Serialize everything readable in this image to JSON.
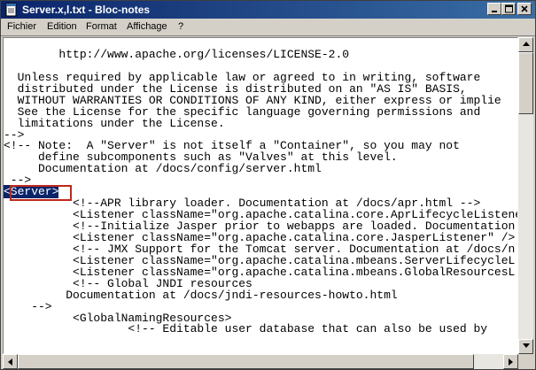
{
  "window": {
    "title": "Server.x,l.txt - Bloc-notes",
    "controls": {
      "minimize": "_",
      "maximize": "□",
      "close": "X"
    }
  },
  "menu": {
    "items": [
      "Fichier",
      "Edition",
      "Format",
      "Affichage",
      "?"
    ]
  },
  "editor": {
    "lines": [
      "",
      "        http://www.apache.org/licenses/LICENSE-2.0",
      "",
      "  Unless required by applicable law or agreed to in writing, software",
      "  distributed under the License is distributed on an \"AS IS\" BASIS,",
      "  WITHOUT WARRANTIES OR CONDITIONS OF ANY KIND, either express or implie",
      "  See the License for the specific language governing permissions and",
      "  limitations under the License.",
      "-->",
      "<!-- Note:  A \"Server\" is not itself a \"Container\", so you may not",
      "     define subcomponents such as \"Valves\" at this level.",
      "     Documentation at /docs/config/server.html",
      " -->",
      "<Server>",
      "          <!--APR library loader. Documentation at /docs/apr.html -->",
      "          <Listener className=\"org.apache.catalina.core.AprLifecycleListene",
      "          <!--Initialize Jasper prior to webapps are loaded. Documentation",
      "          <Listener className=\"org.apache.catalina.core.JasperListener\" />",
      "          <!-- JMX Support for the Tomcat server. Documentation at /docs/n",
      "          <Listener className=\"org.apache.catalina.mbeans.ServerLifecycleL",
      "          <Listener className=\"org.apache.catalina.mbeans.GlobalResourcesL",
      "          <!-- Global JNDI resources",
      "         Documentation at /docs/jndi-resources-howto.html",
      "    -->",
      "          <GlobalNamingResources>",
      "                  <!-- Editable user database that can also be used by"
    ],
    "selected_text": "<Server>"
  },
  "colors": {
    "titlebar_start": "#0a246a",
    "titlebar_end": "#3a6ea5",
    "selection": "#0a246a",
    "annotation_box": "#c0281c"
  },
  "icons": [
    "notepad-icon",
    "minimize-icon",
    "maximize-icon",
    "close-icon",
    "scroll-up-arrow-icon",
    "scroll-down-arrow-icon",
    "scroll-left-arrow-icon",
    "scroll-right-arrow-icon"
  ]
}
